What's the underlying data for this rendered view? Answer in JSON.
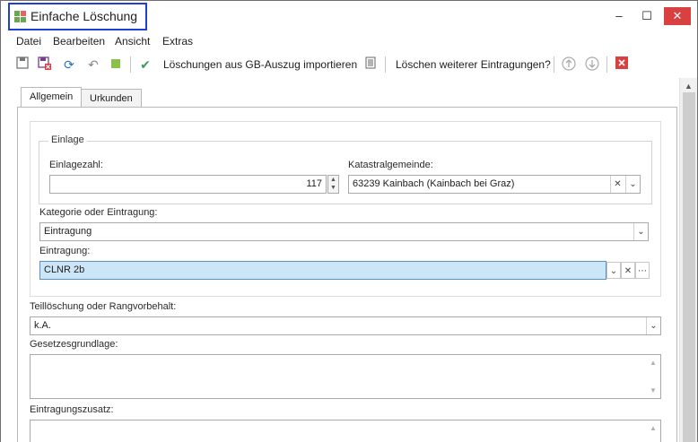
{
  "window": {
    "title": "Einfache Löschung",
    "minimize": "–",
    "maximize": "☐",
    "close": "✕"
  },
  "menu": [
    "Datei",
    "Bearbeiten",
    "Ansicht",
    "Extras"
  ],
  "toolbar": {
    "import_label": "Löschungen aus GB-Auszug importieren",
    "more_label": "Löschen weiterer Eintragungen?"
  },
  "tabs": [
    "Allgemein",
    "Urkunden"
  ],
  "form": {
    "einlage_group": "Einlage",
    "einlagezahl_label": "Einlagezahl:",
    "einlagezahl_value": "117",
    "katastral_label": "Katastralgemeinde:",
    "katastral_value": "63239 Kainbach (Kainbach bei Graz)",
    "kategorie_label": "Kategorie oder Eintragung:",
    "kategorie_value": "Eintragung",
    "eintragung_label": "Eintragung:",
    "eintragung_value": "CLNR 2b",
    "teilloeschung_label": "Teillöschung oder Rangvorbehalt:",
    "teilloeschung_value": "k.A.",
    "gesetz_label": "Gesetzesgrundlage:",
    "zusatz_label": "Eintragungszusatz:"
  },
  "colors": {
    "accent": "#1f3fd0",
    "selected_bg": "#cde6f7",
    "close_red": "#d94040"
  }
}
